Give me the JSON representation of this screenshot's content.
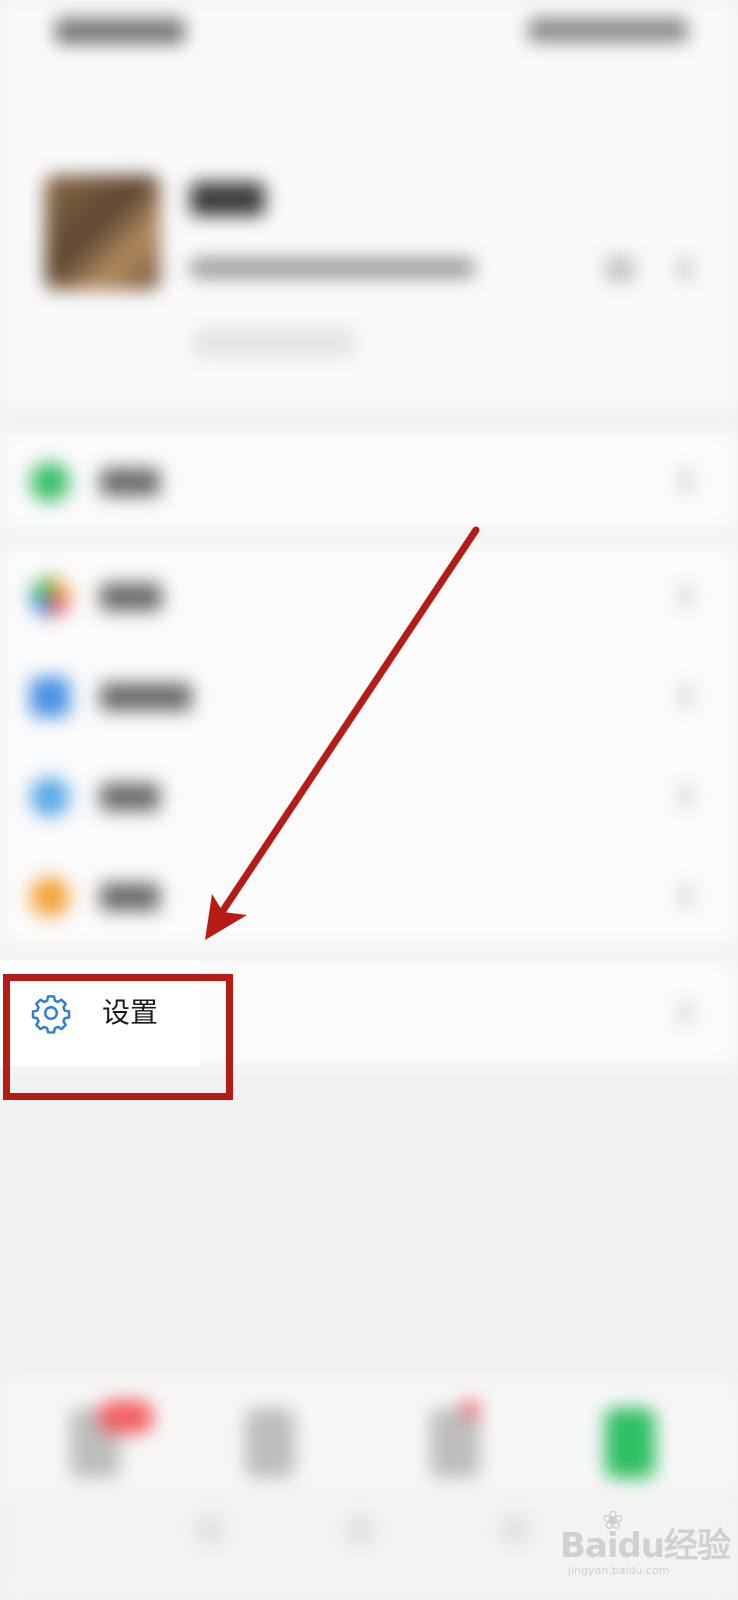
{
  "settings_item": {
    "label": "设置",
    "icon": "gear-icon",
    "icon_color": "#2b7fd4"
  },
  "annotation": {
    "color": "#b51c15",
    "box_target": "settings-item",
    "arrow": "pointing-down-left-to-settings"
  },
  "watermark": {
    "logo": "Baidu经验",
    "subtitle": "jingyan.baidu.com"
  },
  "blurred_menu_icons": [
    "wallet-icon",
    "favorites-icon",
    "moments-icon",
    "cards-icon",
    "emoji-icon"
  ],
  "colors": {
    "wallet": "#3dbf6a",
    "favorites": "#e8a23c",
    "moments": "#4a90e2",
    "cards": "#5aa9e6",
    "emoji": "#f3a43a",
    "badge": "#f26060",
    "active_tab": "#2fbf62"
  }
}
